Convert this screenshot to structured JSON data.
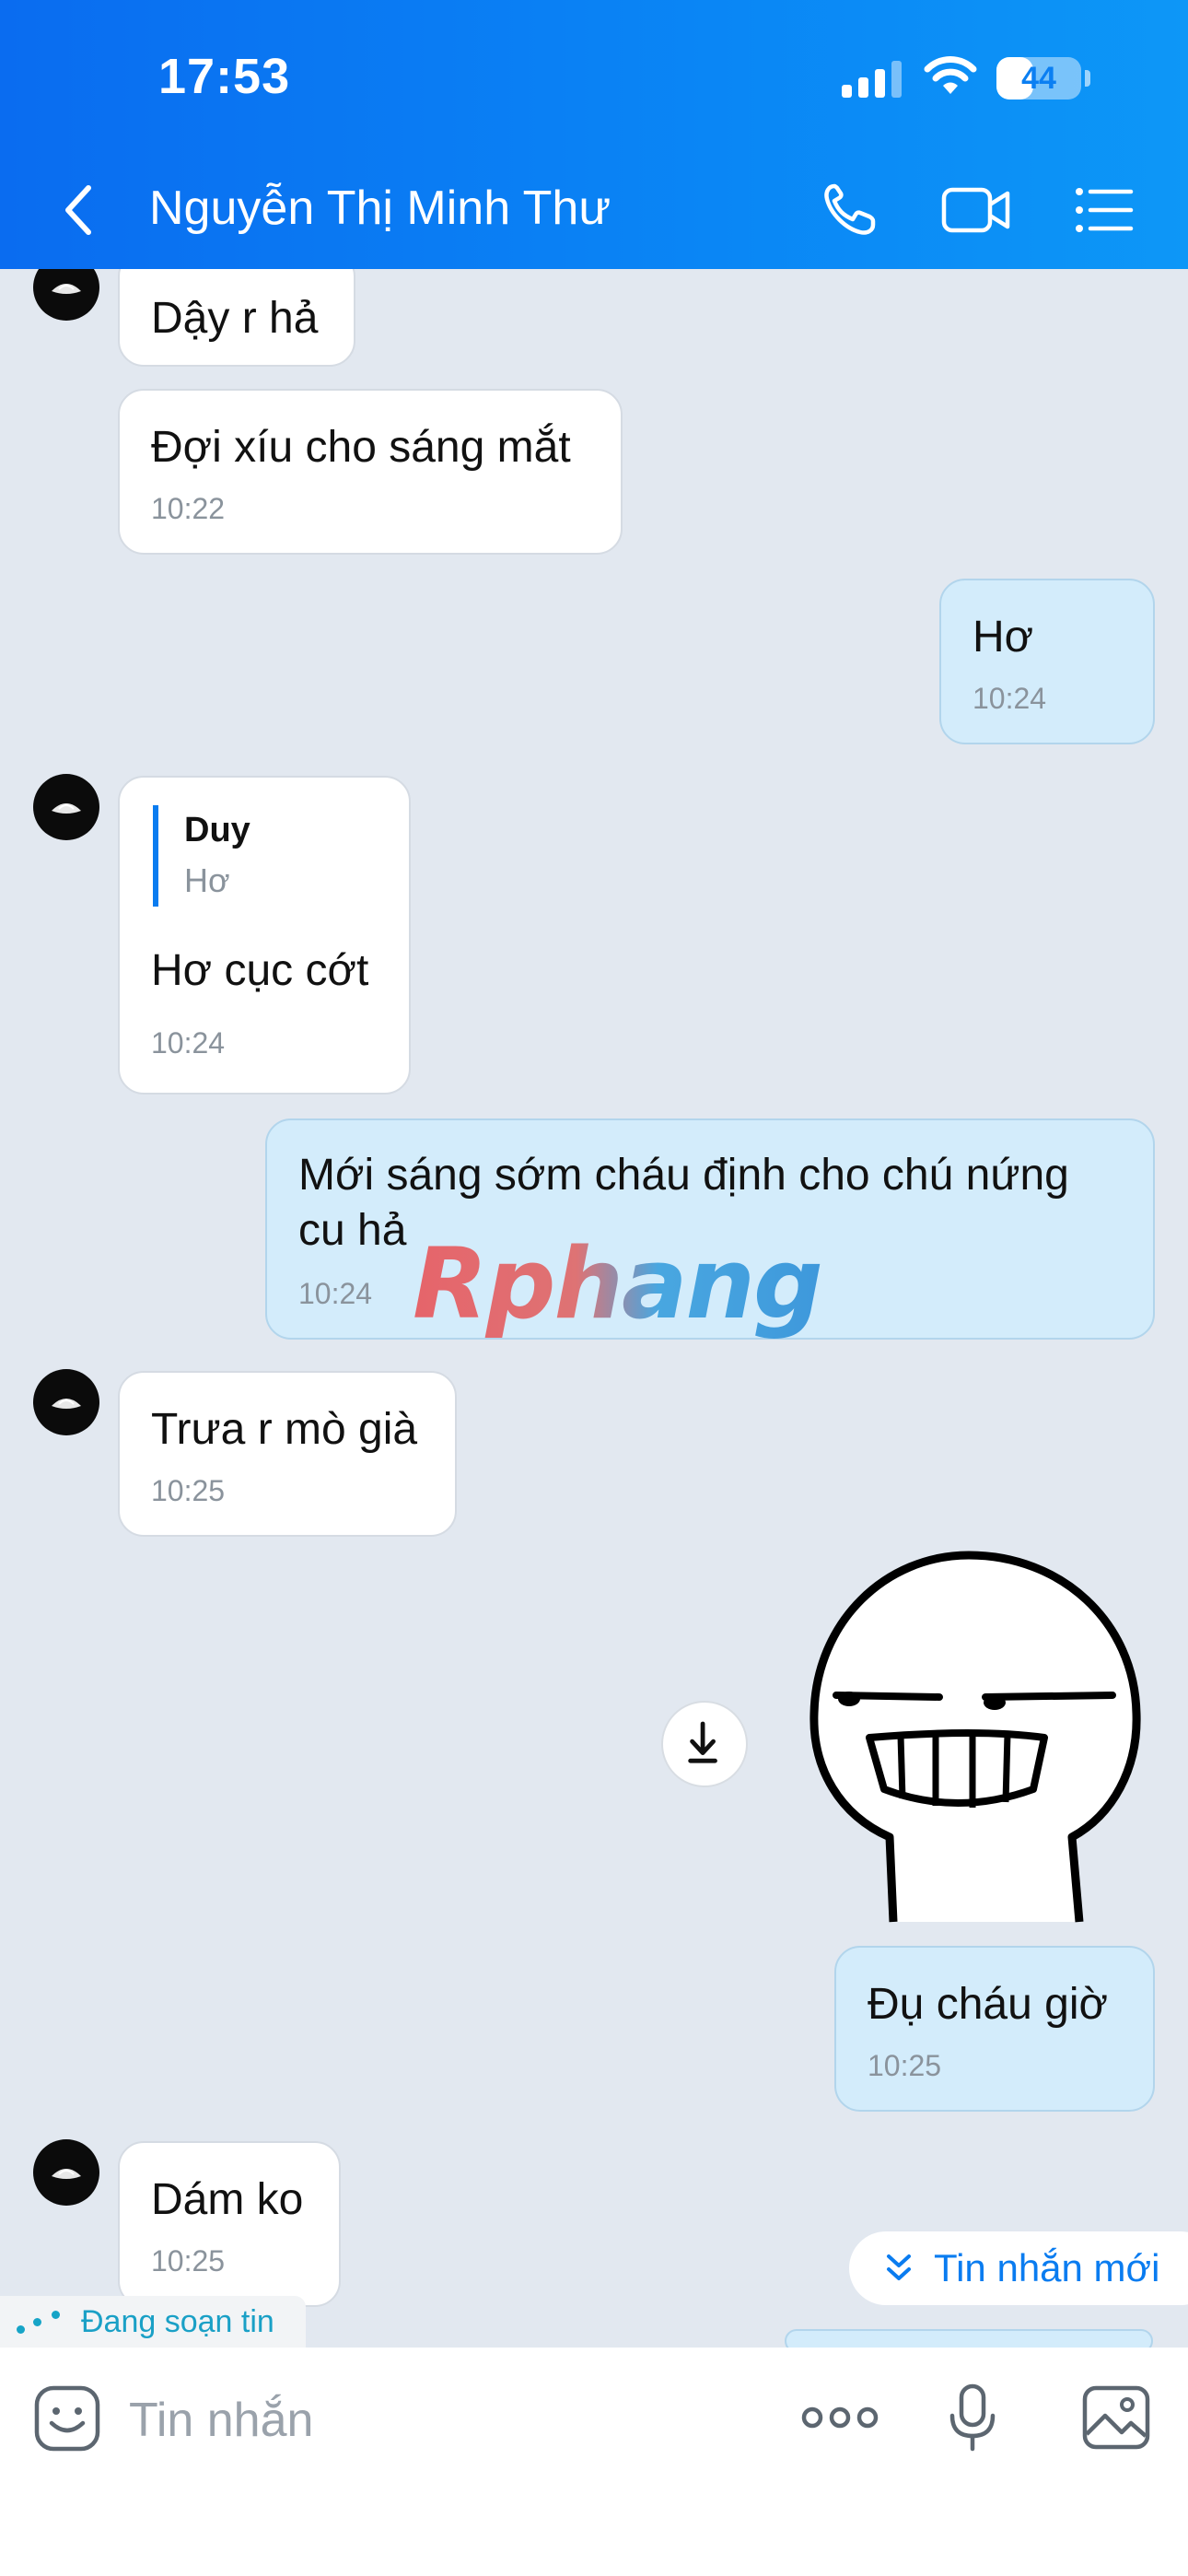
{
  "status_bar": {
    "time": "17:53",
    "battery": "44",
    "battery_level": 0.44
  },
  "header": {
    "contact_name": "Nguyễn Thị Minh Thư"
  },
  "messages": [
    {
      "side": "in",
      "text": "Dậy r hả"
    },
    {
      "side": "in",
      "text": "Đợi xíu cho sáng mắt",
      "time": "10:22"
    },
    {
      "side": "out",
      "text": "Hơ",
      "time": "10:24"
    },
    {
      "side": "in",
      "quote_name": "Duy",
      "quote_text": "Hơ",
      "text": "Hơ cục cớt",
      "time": "10:24"
    },
    {
      "side": "out",
      "text": "Mới sáng sớm cháu định cho chú nứng cu hả",
      "time": "10:24"
    },
    {
      "side": "in",
      "text": "Trưa r mò già",
      "time": "10:25"
    },
    {
      "side": "out",
      "type": "sticker"
    },
    {
      "side": "out",
      "text": "Đụ cháu giờ",
      "time": "10:25"
    },
    {
      "side": "in",
      "text": "Dám ko",
      "time": "10:25"
    }
  ],
  "watermark": "Rphang",
  "new_messages_label": "Tin nhắn mới",
  "typing_label": "Đang soạn tin",
  "input": {
    "placeholder": "Tin nhắn"
  },
  "colors": {
    "header": "#0a7cf0",
    "chat_bg": "#e2e8f0",
    "outgoing": "#d3ecfb",
    "incoming": "#ffffff",
    "accent": "#0a7cf0"
  },
  "icons": [
    "back-icon",
    "phone-icon",
    "video-call-icon",
    "menu-list-icon",
    "download-icon",
    "chevron-double-down-icon",
    "emoji-icon",
    "more-icon",
    "microphone-icon",
    "image-icon"
  ]
}
